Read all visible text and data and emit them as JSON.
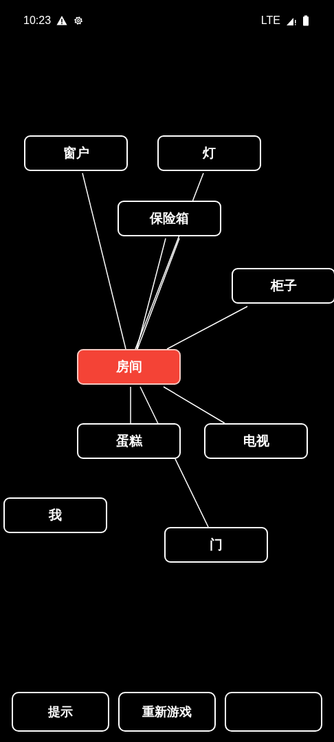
{
  "status_bar": {
    "time": "10:23",
    "network": "LTE"
  },
  "nodes": [
    {
      "label": "窗户",
      "selected": false
    },
    {
      "label": "灯",
      "selected": false
    },
    {
      "label": "保险箱",
      "selected": false
    },
    {
      "label": "柜子",
      "selected": false
    },
    {
      "label": "房间",
      "selected": true
    },
    {
      "label": "蛋糕",
      "selected": false
    },
    {
      "label": "电视",
      "selected": false
    },
    {
      "label": "我",
      "selected": false
    },
    {
      "label": "门",
      "selected": false
    }
  ],
  "buttons": [
    {
      "label": "提示"
    },
    {
      "label": "重新游戏"
    }
  ]
}
